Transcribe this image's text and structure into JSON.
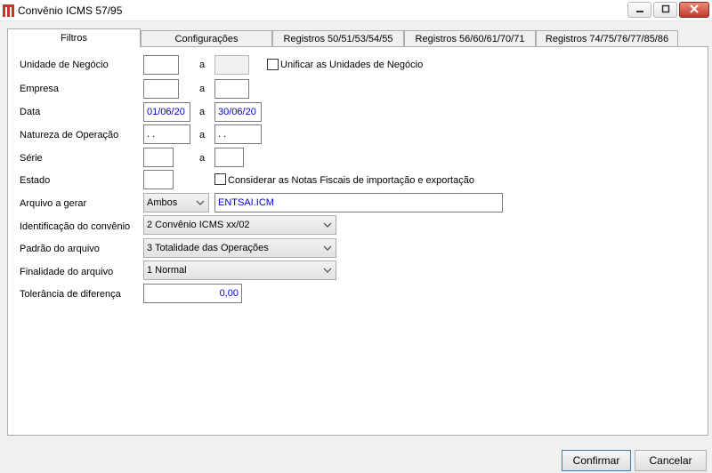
{
  "window": {
    "title": "Convênio ICMS 57/95"
  },
  "tabs": [
    {
      "label": "Filtros"
    },
    {
      "label": "Configurações"
    },
    {
      "label": "Registros 50/51/53/54/55"
    },
    {
      "label": "Registros 56/60/61/70/71"
    },
    {
      "label": "Registros 74/75/76/77/85/86"
    }
  ],
  "form": {
    "range_sep": "a",
    "unidade_negocio": {
      "label": "Unidade de Negócio",
      "from": "",
      "to": ""
    },
    "unificar": {
      "label": "Unificar as Unidades de Negócio",
      "checked": false
    },
    "empresa": {
      "label": "Empresa",
      "from": "",
      "to": ""
    },
    "data": {
      "label": "Data",
      "from": "01/06/20",
      "to": "30/06/20"
    },
    "natureza": {
      "label": "Natureza de Operação",
      "from": " .  .",
      "to": " .  ."
    },
    "serie": {
      "label": "Série",
      "from": "",
      "to": ""
    },
    "estado": {
      "label": "Estado",
      "value": ""
    },
    "considerar": {
      "label": "Considerar as Notas Fiscais de importação e exportação",
      "checked": false
    },
    "arquivo": {
      "label": "Arquivo a gerar",
      "selected": "Ambos",
      "filename": "ENTSAI.ICM"
    },
    "identificacao": {
      "label": "Identificação do convênio",
      "selected": "2 Convênio ICMS xx/02"
    },
    "padrao": {
      "label": "Padrão do arquivo",
      "selected": "3 Totalidade das Operações"
    },
    "finalidade": {
      "label": "Finalidade do arquivo",
      "selected": "1 Normal"
    },
    "tolerancia": {
      "label": "Tolerância de diferença",
      "value": "0,00"
    }
  },
  "footer": {
    "confirm_label": "Confirmar",
    "cancel_label": "Cancelar"
  },
  "colors": {
    "field_text": "#0000c8",
    "close_button": "#c0392b",
    "app_icon": "#c0392b"
  },
  "icons": {
    "app": "app-logo-icon",
    "minimize": "minimize-icon",
    "maximize": "maximize-icon",
    "close": "close-icon",
    "dropdown": "chevron-down-icon"
  }
}
